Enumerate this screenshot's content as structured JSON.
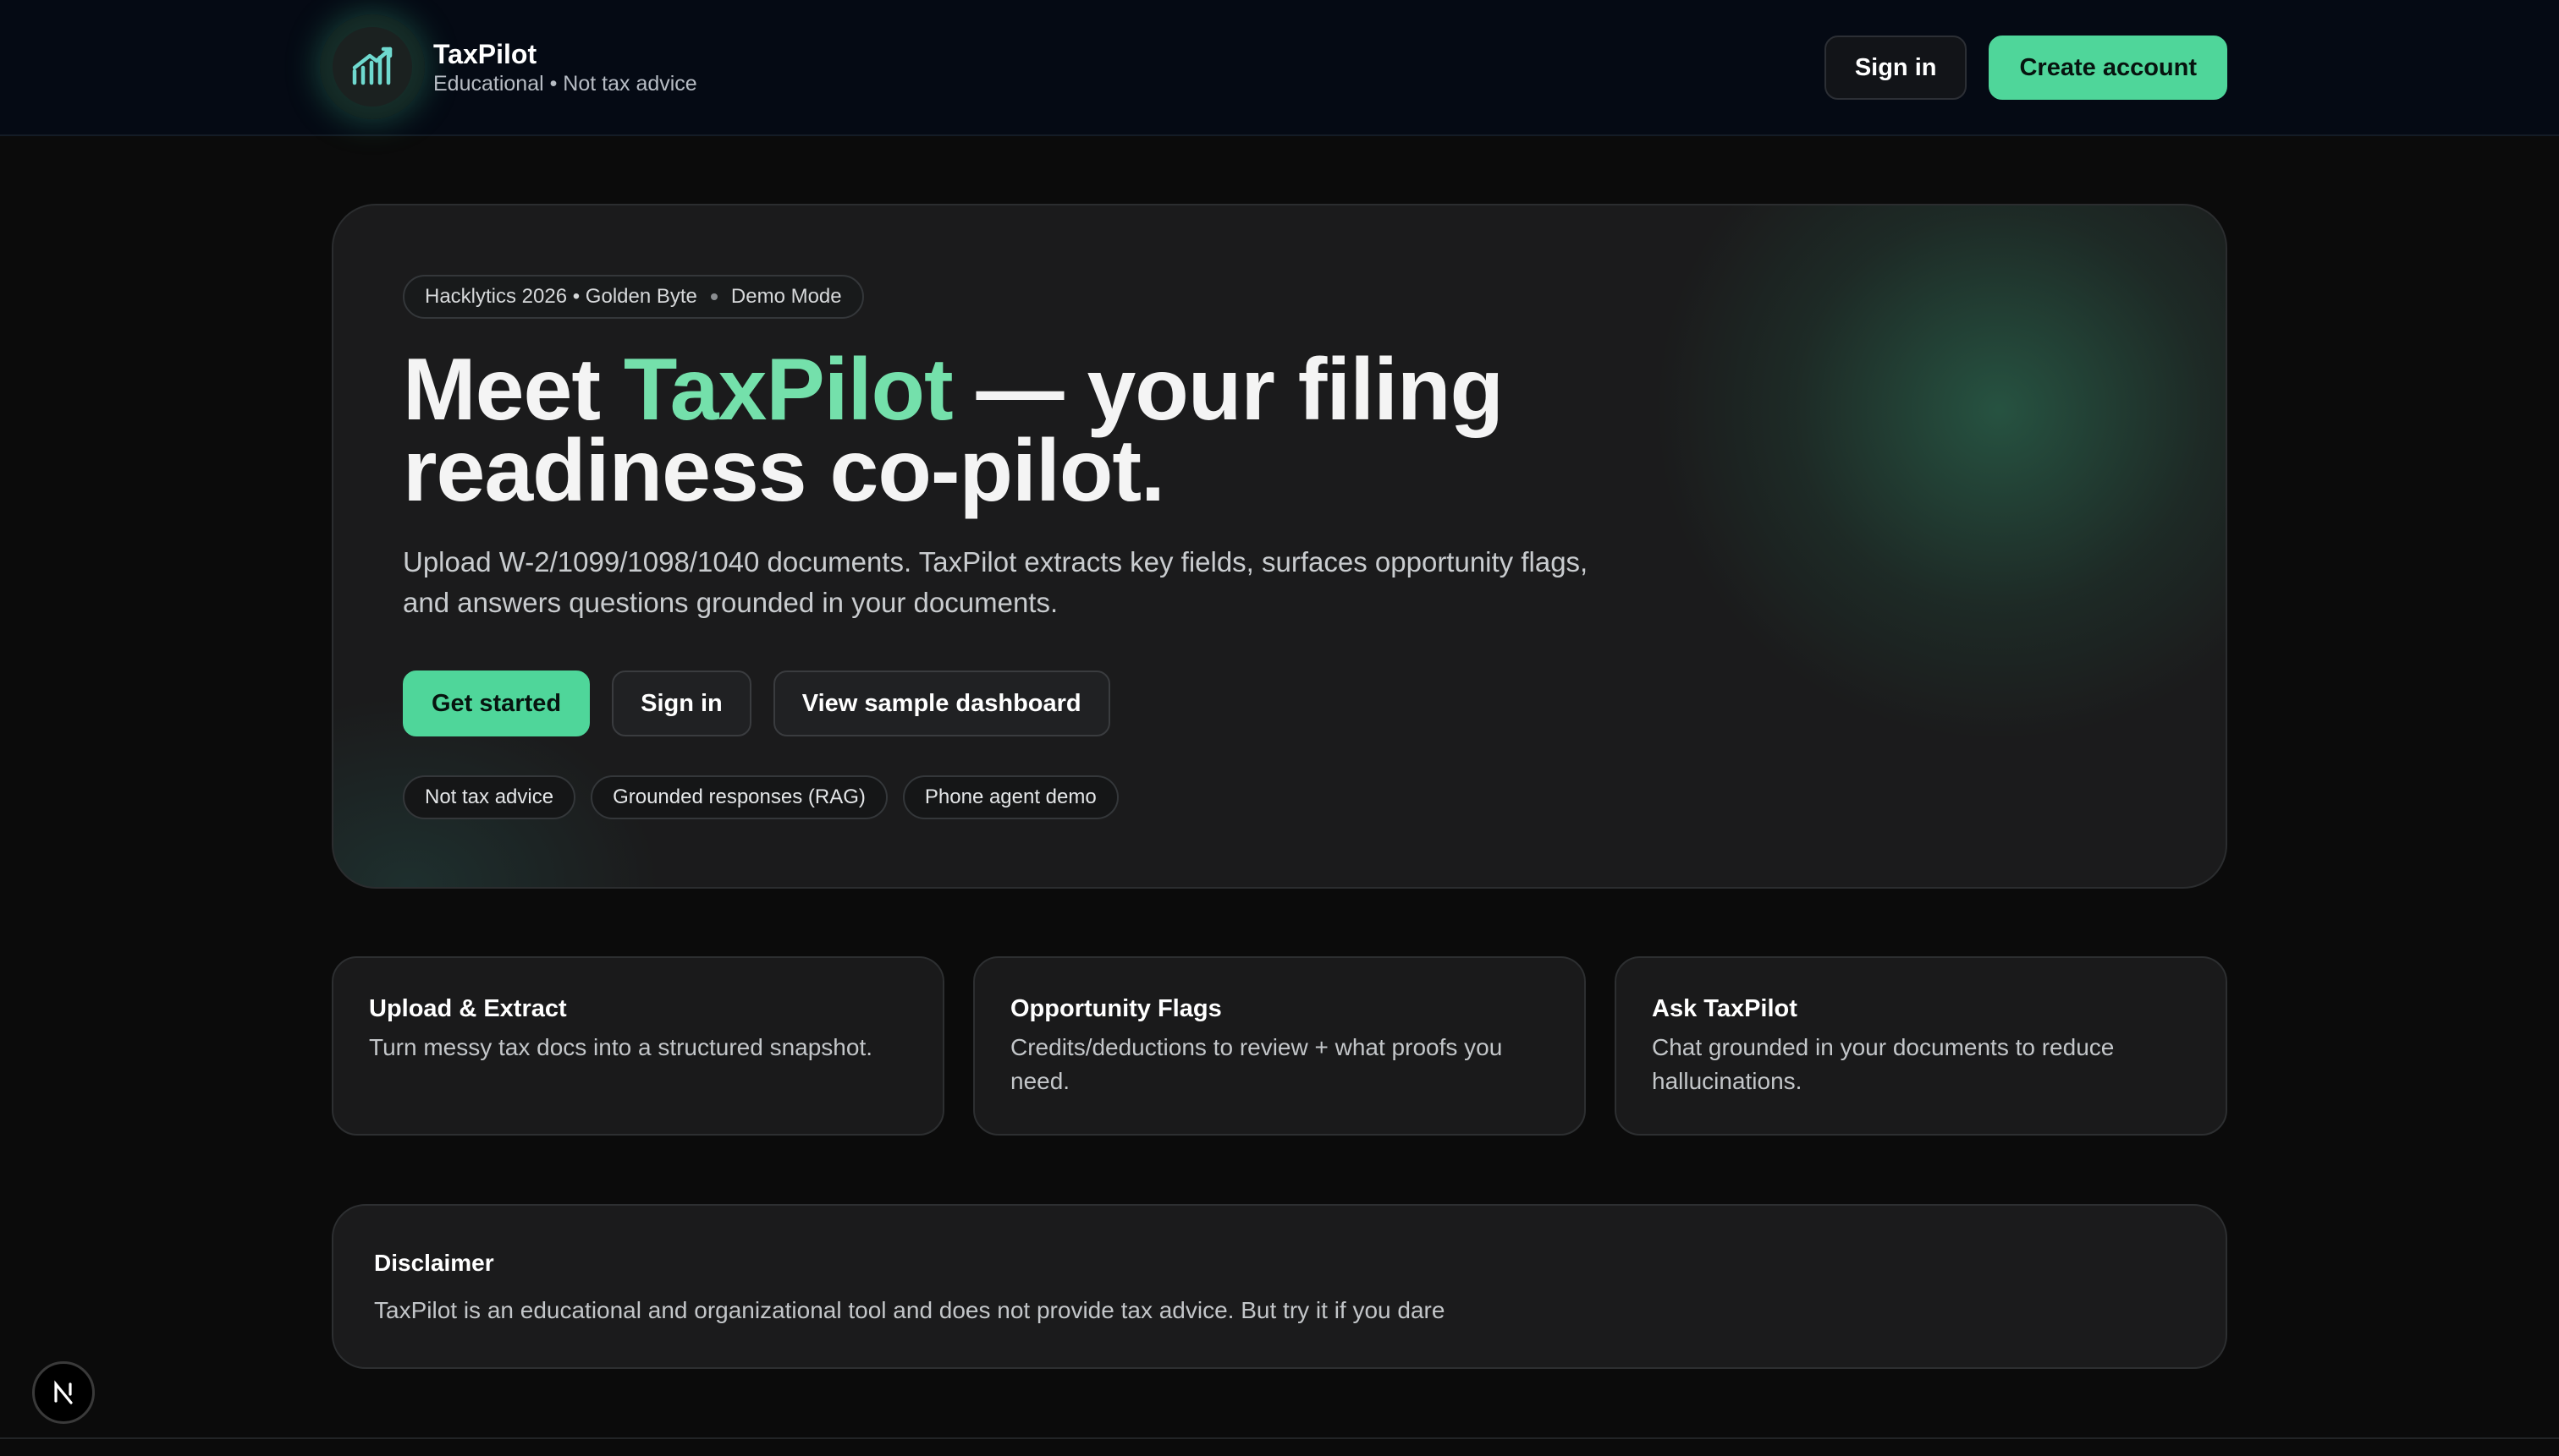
{
  "app": {
    "name": "TaxPilot",
    "tagline": "Educational • Not tax advice",
    "logo_icon": "trend-chart-icon"
  },
  "nav": {
    "sign_in": "Sign in",
    "create_account": "Create account"
  },
  "hero": {
    "pill_event": "Hacklytics 2026 • Golden Byte",
    "pill_mode": "Demo Mode",
    "title_prefix": "Meet ",
    "title_accent": "TaxPilot",
    "title_suffix": " — your filing readiness co-pilot.",
    "description": "Upload W-2/1099/1098/1040 documents. TaxPilot extracts key fields, surfaces opportunity flags, and answers questions grounded in your documents.",
    "buttons": {
      "get_started": "Get started",
      "sign_in": "Sign in",
      "view_sample": "View sample dashboard"
    },
    "chips": [
      "Not tax advice",
      "Grounded responses (RAG)",
      "Phone agent demo"
    ]
  },
  "features": [
    {
      "title": "Upload & Extract",
      "text": "Turn messy tax docs into a structured snapshot."
    },
    {
      "title": "Opportunity Flags",
      "text": "Credits/deductions to review + what proofs you need."
    },
    {
      "title": "Ask TaxPilot",
      "text": "Chat grounded in your documents to reduce hallucinations."
    }
  ],
  "disclaimer": {
    "title": "Disclaimer",
    "text": "TaxPilot is an educational and organizational tool and does not provide tax advice. But try it if you dare"
  },
  "colors": {
    "accent": "#74e0ab",
    "button_green": "#4fd69a",
    "background": "#0b0b0b",
    "nav_background": "#050a14"
  }
}
